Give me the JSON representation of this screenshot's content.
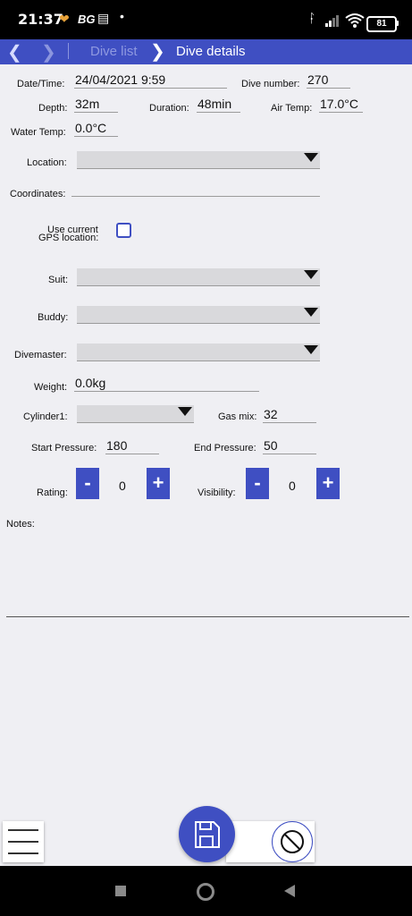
{
  "status_bar": {
    "time": "21:37",
    "carrier_badge": "BG",
    "battery": "81"
  },
  "nav": {
    "crumb_dive_list": "Dive list",
    "crumb_dive_details": "Dive details"
  },
  "form": {
    "datetime_label": "Date/Time:",
    "datetime_value": "24/04/2021 9:59",
    "dive_number_label": "Dive number:",
    "dive_number_value": "270",
    "depth_label": "Depth:",
    "depth_value": "32m",
    "duration_label": "Duration:",
    "duration_value": "48min",
    "air_temp_label": "Air Temp:",
    "air_temp_value": "17.0°C",
    "water_temp_label": "Water Temp:",
    "water_temp_value": "0.0°C",
    "location_label": "Location:",
    "coordinates_label": "Coordinates:",
    "gps_label_line1": "Use current",
    "gps_label_line2": "GPS location:",
    "suit_label": "Suit:",
    "buddy_label": "Buddy:",
    "divemaster_label": "Divemaster:",
    "weight_label": "Weight:",
    "weight_value": "0.0kg",
    "cylinder_label": "Cylinder1:",
    "gas_mix_label": "Gas mix:",
    "gas_mix_value": "32",
    "start_pressure_label": "Start Pressure:",
    "start_pressure_value": "180",
    "end_pressure_label": "End Pressure:",
    "end_pressure_value": "50",
    "rating_label": "Rating:",
    "rating_value": "0",
    "visibility_label": "Visibility:",
    "visibility_value": "0",
    "minus": "-",
    "plus": "+",
    "notes_label": "Notes:"
  },
  "colors": {
    "accent": "#3f4fc2",
    "background": "#efeff3"
  }
}
